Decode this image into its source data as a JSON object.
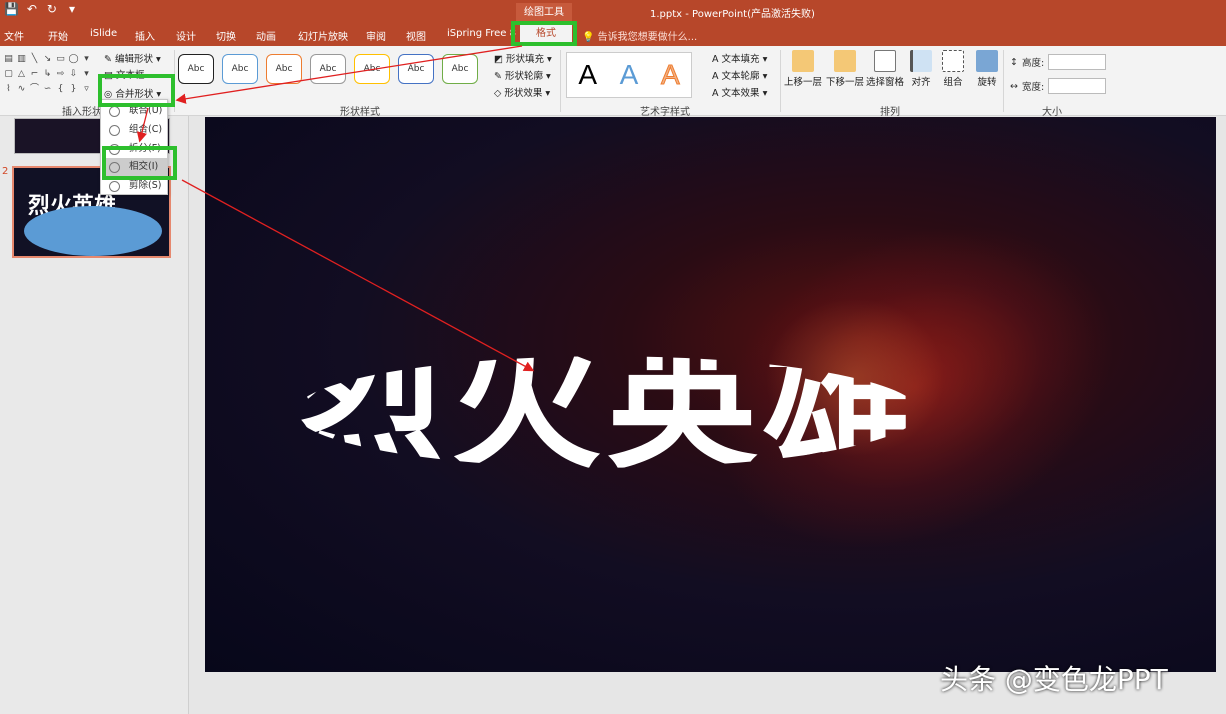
{
  "quick_access": {
    "save": "💾",
    "undo": "↶",
    "redo": "↻",
    "customize": "▾"
  },
  "context_tab_group": "绘图工具",
  "window_title": "1.pptx - PowerPoint(产品激活失败)",
  "tabs": [
    "文件",
    "开始",
    "iSlide",
    "插入",
    "设计",
    "切换",
    "动画",
    "幻灯片放映",
    "审阅",
    "视图",
    "iSpring Free 8"
  ],
  "active_tab": "格式",
  "tell_me": "告诉我您想要做什么...",
  "ribbon": {
    "insert_shapes": {
      "label": "插入形状",
      "edit_shape": "编辑形状",
      "text_box": "文本框",
      "merge_shapes": "合并形状"
    },
    "shape_styles": {
      "label": "形状样式",
      "swatch_text": "Abc",
      "fill": "形状填充",
      "outline": "形状轮廓",
      "effects": "形状效果"
    },
    "wordart": {
      "label": "艺术字样式",
      "letter": "A",
      "text_fill": "文本填充",
      "text_outline": "文本轮廓",
      "text_effects": "文本效果"
    },
    "arrange": {
      "label": "排列",
      "bring_forward": "上移一层",
      "send_backward": "下移一层",
      "selection_pane": "选择窗格",
      "align": "对齐",
      "group": "组合",
      "rotate": "旋转"
    },
    "size": {
      "label": "大小",
      "height": "高度:",
      "width": "宽度:"
    }
  },
  "merge_menu": [
    {
      "label": "联合(U)",
      "selected": false
    },
    {
      "label": "组合(C)",
      "selected": false
    },
    {
      "label": "拆分(F)",
      "selected": false
    },
    {
      "label": "相交(I)",
      "selected": true
    },
    {
      "label": "剪除(S)",
      "selected": false
    }
  ],
  "slides": {
    "second_number": "2",
    "thumb_title": "烈火英雄"
  },
  "slide_text": "烈火英雄",
  "watermark": "头条 @变色龙PPT",
  "colors": {
    "accent": "#b7472a",
    "highlight": "#2dbf2d",
    "arrow": "#e02020",
    "oval": "#5b9bd5"
  }
}
